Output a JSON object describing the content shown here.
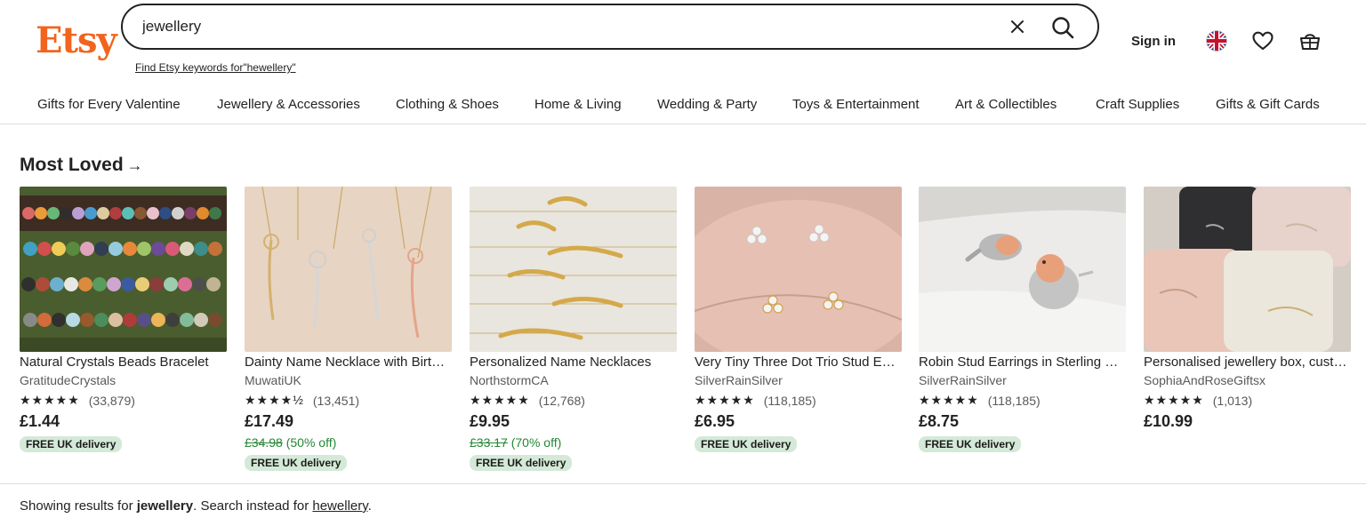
{
  "header": {
    "logo": "Etsy",
    "search_value": "jewellery",
    "suggest_link": "Find Etsy keywords for\"hewellery\"",
    "signin": "Sign in"
  },
  "categories": [
    "Gifts for Every Valentine",
    "Jewellery & Accessories",
    "Clothing & Shoes",
    "Home & Living",
    "Wedding & Party",
    "Toys & Entertainment",
    "Art & Collectibles",
    "Craft Supplies",
    "Gifts & Gift Cards"
  ],
  "section": {
    "title": "Most Loved",
    "arrow": "→"
  },
  "products": [
    {
      "title": "Natural Crystals Beads Bracelet",
      "shop": "GratitudeCrystals",
      "stars": "★★★★★",
      "reviews": "(33,879)",
      "price": "£1.44",
      "orig": "",
      "off": "",
      "delivery": "FREE UK delivery"
    },
    {
      "title": "Dainty Name Necklace with Birth Flower",
      "shop": "MuwatiUK",
      "stars": "★★★★½",
      "reviews": "(13,451)",
      "price": "£17.49",
      "orig": "£34.98",
      "off": " (50% off)",
      "delivery": "FREE UK delivery"
    },
    {
      "title": "Personalized Name Necklaces",
      "shop": "NorthstormCA",
      "stars": "★★★★★",
      "reviews": "(12,768)",
      "price": "£9.95",
      "orig": "£33.17",
      "off": " (70% off)",
      "delivery": "FREE UK delivery"
    },
    {
      "title": "Very Tiny Three Dot Trio Stud Earrings",
      "shop": "SilverRainSilver",
      "stars": "★★★★★",
      "reviews": "(118,185)",
      "price": "£6.95",
      "orig": "",
      "off": "",
      "delivery": "FREE UK delivery"
    },
    {
      "title": "Robin Stud Earrings in Sterling Silver",
      "shop": "SilverRainSilver",
      "stars": "★★★★★",
      "reviews": "(118,185)",
      "price": "£8.75",
      "orig": "",
      "off": "",
      "delivery": "FREE UK delivery"
    },
    {
      "title": "Personalised jewellery box, custom",
      "shop": "SophiaAndRoseGiftsx",
      "stars": "★★★★★",
      "reviews": "(1,013)",
      "price": "£10.99",
      "orig": "",
      "off": "",
      "delivery": ""
    }
  ],
  "footer": {
    "prefix": "Showing results for ",
    "query": "jewellery",
    "middle": ". Search instead for ",
    "alt": "hewellery",
    "suffix": "."
  },
  "colors": {
    "brand": "#F1641E",
    "badge_bg": "#d4e9d7",
    "sale_green": "#258635"
  }
}
